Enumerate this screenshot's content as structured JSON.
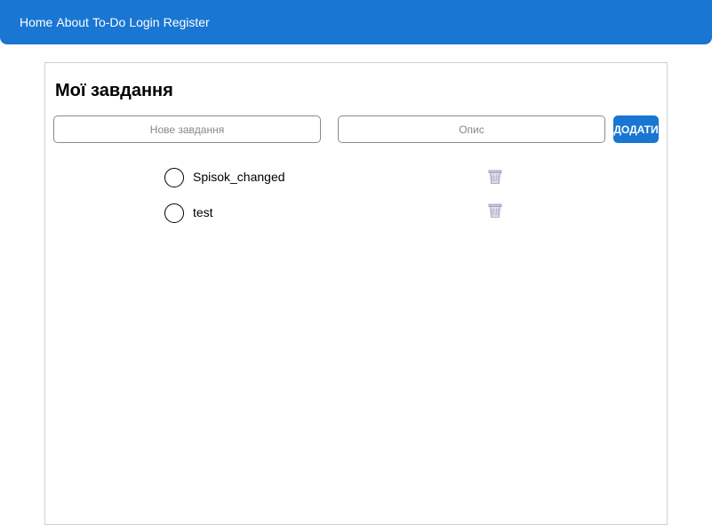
{
  "nav": {
    "links": [
      "Home",
      "About",
      "To-Do",
      "Login",
      "Register"
    ]
  },
  "page": {
    "title": "Мої завдання"
  },
  "form": {
    "task_placeholder": "Нове завдання",
    "desc_placeholder": "Опис",
    "add_label": "ДОДАТИ"
  },
  "tasks": [
    {
      "label": "Spisok_changed",
      "done": false
    },
    {
      "label": "test",
      "done": false
    }
  ],
  "colors": {
    "accent": "#1976d2"
  },
  "icons": {
    "delete": "trash-icon",
    "checkbox": "circle-checkbox-icon"
  }
}
